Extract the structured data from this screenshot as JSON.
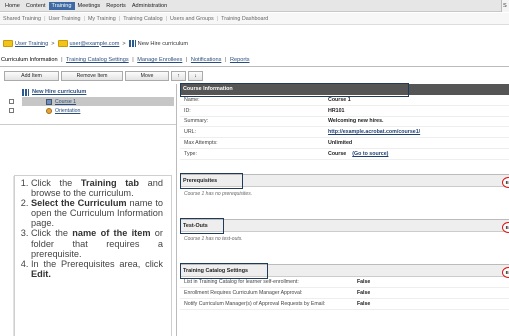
{
  "topnav": {
    "items": [
      "Home",
      "Content",
      "Training",
      "Meetings",
      "Reports",
      "Administration"
    ],
    "active_index": 2,
    "search_cut": "S"
  },
  "subnav": {
    "items": [
      "Shared Training",
      "User Training",
      "My Training",
      "Training Catalog",
      "Users and Groups",
      "Training Dashboard"
    ]
  },
  "breadcrumb": {
    "user_training": "User Training",
    "user_email": "user@example.com",
    "curriculum": "New Hire curriculum",
    "separator": ">"
  },
  "tabs": {
    "items": [
      "Curriculum Information",
      "Training Catalog Settings",
      "Manage Enrollees",
      "Notifications",
      "Reports"
    ],
    "separator": "|"
  },
  "toolbar": {
    "add_item": "Add Item",
    "remove_item": "Remove Item",
    "move": "Move",
    "up": "↑",
    "down": "↓"
  },
  "tree": {
    "root": "New Hire curriculum",
    "items": [
      "Course 1",
      "Orientation"
    ]
  },
  "instructions": {
    "steps": [
      {
        "pre": "Click the ",
        "bold": "Training tab",
        "post": " and browse to the curriculum."
      },
      {
        "pre": "",
        "bold": "Select the Curriculum",
        "post": " name to open the Curriculum Information page."
      },
      {
        "pre": "Click the ",
        "bold": "name of the item",
        "post": " or folder that requires a prerequisite."
      },
      {
        "pre": "In the Prerequisites area, click ",
        "bold": "Edit.",
        "post": ""
      }
    ]
  },
  "course_info": {
    "header": "Course Information",
    "rows": [
      {
        "label": "Name:",
        "value": "Course 1"
      },
      {
        "label": "ID:",
        "value": "HR101"
      },
      {
        "label": "Summary:",
        "value": "Welcoming new hires."
      },
      {
        "label": "URL:",
        "value": "http://example.acrobat.com/course1/"
      },
      {
        "label": "Max Attempts:",
        "value": "Unlimited"
      },
      {
        "label": "Type:",
        "value": "Course",
        "extra": "(Go to source)"
      }
    ]
  },
  "prerequisites": {
    "header": "Prerequisites",
    "note": "Course 1 has no prerequisites.",
    "edit": "Ed"
  },
  "testouts": {
    "header": "Test-Outs",
    "note": "Course 1 has no test-outs.",
    "edit": "Ed"
  },
  "catalog_settings": {
    "header": "Training Catalog Settings",
    "edit": "Ed",
    "rows": [
      {
        "label": "List in Training Catalog for learner self-enrollment:",
        "value": "False"
      },
      {
        "label": "Enrollment Requires Curriculum Manager Approval:",
        "value": "False"
      },
      {
        "label": "Notify Curriculum Manager(s) of Approval Requests by Email:",
        "value": "False"
      }
    ]
  },
  "colors": {
    "active_tab": "#3d6aa3",
    "header_dark": "#555555",
    "link": "#2a4d80",
    "highlight_box": "#1f3a5a",
    "edit_circle": "#dd1111"
  }
}
